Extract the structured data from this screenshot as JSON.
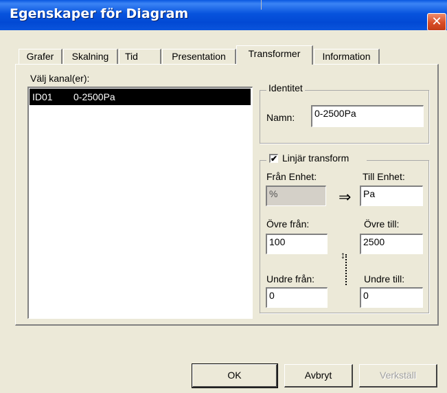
{
  "window": {
    "title": "Egenskaper för Diagram",
    "close_symbol": "✕"
  },
  "tabs": [
    {
      "label": "Grafer"
    },
    {
      "label": "Skalning"
    },
    {
      "label": "Tid"
    },
    {
      "label": "Presentation"
    },
    {
      "label": "Transformer",
      "active": true
    },
    {
      "label": "Information"
    }
  ],
  "channels": {
    "label": "Välj kanal(er):",
    "items": [
      {
        "id": "ID01",
        "name": "0-2500Pa",
        "selected": true
      }
    ]
  },
  "identity": {
    "title": "Identitet",
    "name_label": "Namn:",
    "name_value": "0-2500Pa"
  },
  "transform": {
    "checkbox_label": "Linjär transform",
    "checked": true,
    "from_unit_label": "Från Enhet:",
    "from_unit_value": "%",
    "to_unit_label": "Till Enhet:",
    "to_unit_value": "Pa",
    "upper_from_label": "Övre från:",
    "upper_from_value": "100",
    "upper_to_label": "Övre till:",
    "upper_to_value": "2500",
    "lower_from_label": "Undre från:",
    "lower_from_value": "0",
    "lower_to_label": "Undre till:",
    "lower_to_value": "0",
    "arrow_symbol": "⇒",
    "range_symbol": "↕"
  },
  "buttons": {
    "ok": "OK",
    "cancel": "Avbryt",
    "apply": "Verkställ"
  },
  "colors": {
    "title_bar": "#0753dd",
    "dialog_bg": "#ece9d8",
    "selection": "#000000",
    "close_button": "#d94d26"
  }
}
